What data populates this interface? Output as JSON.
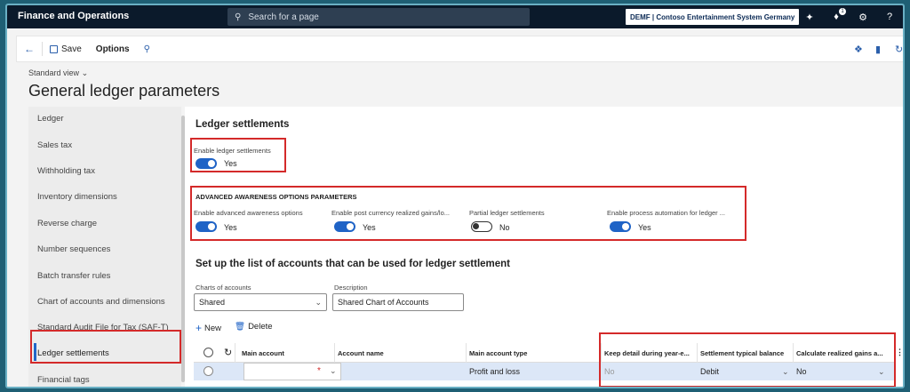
{
  "topbar": {
    "app_title": "Finance and Operations",
    "search_placeholder": "Search for a page",
    "company": "DEMF | Contoso Entertainment System Germany",
    "notification_count": "1"
  },
  "actionbar": {
    "save_label": "Save",
    "options_label": "Options"
  },
  "page": {
    "view": "Standard view",
    "title": "General ledger parameters"
  },
  "nav": {
    "items": [
      "Ledger",
      "Sales tax",
      "Withholding tax",
      "Inventory dimensions",
      "Reverse charge",
      "Number sequences",
      "Batch transfer rules",
      "Chart of accounts and dimensions",
      "Standard Audit File for Tax (SAF-T)",
      "Ledger settlements",
      "Financial tags"
    ],
    "selected": "Ledger settlements"
  },
  "content": {
    "section_title": "Ledger settlements",
    "enable": {
      "label": "Enable ledger settlements",
      "value": "Yes"
    },
    "advanced_header": "ADVANCED AWARENESS OPTIONS PARAMETERS",
    "advanced": [
      {
        "label": "Enable advanced awareness options",
        "value": "Yes",
        "state": "on"
      },
      {
        "label": "Enable post currency realized gains/lo...",
        "value": "Yes",
        "state": "on"
      },
      {
        "label": "Partial ledger settlements",
        "value": "No",
        "state": "off"
      },
      {
        "label": "Enable process automation for ledger ...",
        "value": "Yes",
        "state": "on"
      }
    ],
    "accounts_title": "Set up the list of accounts that can be used for ledger settlement",
    "charts_label": "Charts of accounts",
    "charts_value": "Shared",
    "description_label": "Description",
    "description_value": "Shared Chart of Accounts",
    "new_label": "New",
    "delete_label": "Delete",
    "grid": {
      "columns": [
        "Main account",
        "Account name",
        "Main account type",
        "Keep detail during year-e...",
        "Settlement typical balance",
        "Calculate realized gains a..."
      ],
      "row": {
        "main_account": "",
        "required_mark": "*",
        "account_name": "",
        "main_account_type": "Profit and loss",
        "keep_detail": "No",
        "typical_balance": "Debit",
        "calculate_gains": "No"
      }
    }
  },
  "colors": {
    "accent": "#1f63c6",
    "highlight_box": "#d42a2a",
    "topbar": "#0b1a2b"
  }
}
